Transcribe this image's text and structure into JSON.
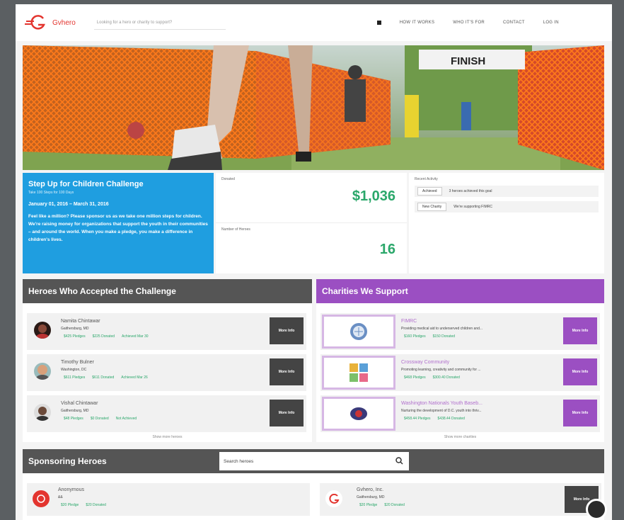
{
  "brand": {
    "name": "Gvhero",
    "accent": "#e3352f"
  },
  "search": {
    "placeholder": "Looking for a hero or charity to support?"
  },
  "nav": {
    "links": [
      "HOW IT WORKS",
      "WHO IT'S FOR",
      "CONTACT",
      "LOG IN"
    ]
  },
  "hero": {
    "finish_banner": "FINISH"
  },
  "challenge": {
    "title": "Step Up for Children Challenge",
    "subtitle": "Take 100 Steps for 100 Days",
    "dates": "January 01, 2016 – March 31, 2016",
    "description": "Feel like a million? Please sponsor us as we take one million steps for children. We're raising money for organizations that support the youth in their communities – and around the world. When you make a pledge, you make a difference in children's lives."
  },
  "stats": {
    "donated_label": "Donated",
    "donated_value": "$1,036",
    "heroes_label": "Number of Heroes",
    "heroes_value": "16"
  },
  "activity": {
    "label": "Recent Activity",
    "items": [
      {
        "tag": "Achieved",
        "text": "3 heroes achieved this goal"
      },
      {
        "tag": "New Charity",
        "text": "We're supporting FIMRC"
      }
    ]
  },
  "heroes": {
    "title": "Heroes Who Accepted the Challenge",
    "rows": [
      {
        "name": "Namita Chintawar",
        "location": "Gaithersburg, MD",
        "pledges": "$425 Pledges",
        "donated": "$225 Donated",
        "status": "Achieved Mar 30"
      },
      {
        "name": "Timothy Bulner",
        "location": "Washington, DC",
        "pledges": "$611 Pledges",
        "donated": "$611 Donated",
        "status": "Achieved Mar 26"
      },
      {
        "name": "Vishal Chintawar",
        "location": "Gaithersburg, MD",
        "pledges": "$48 Pledges",
        "donated": "$0 Donated",
        "status": "Not Achieved"
      }
    ],
    "more_label": "More Info",
    "show_more": "Show more heroes"
  },
  "charities": {
    "title": "Charities We Support",
    "rows": [
      {
        "name": "FIMRC",
        "desc": "Providing medical aid to underserved children and...",
        "pledges": "$160 Pledges",
        "donated": "$150 Donated"
      },
      {
        "name": "Crossway Community",
        "desc": "Promoting learning, creativity and community for ...",
        "pledges": "$468 Pledges",
        "donated": "$300.40 Donated"
      },
      {
        "name": "Washington Nationals Youth Baseb...",
        "desc": "Nurturing the development of D.C. youth into thriv...",
        "pledges": "$458.44 Pledges",
        "donated": "$438.44 Donated"
      }
    ],
    "more_label": "More Info",
    "show_more": "Show more charities"
  },
  "sponsoring": {
    "title": "Sponsoring Heroes",
    "search_placeholder": "Search heroes",
    "cards": [
      {
        "name": "Anonymous",
        "location": "&&",
        "pledges": "$20 Pledge",
        "donated": "$20 Donated"
      },
      {
        "name": "Gvhero, Inc.",
        "location": "Gaithersburg, MD",
        "pledges": "$20 Pledge",
        "donated": "$20 Donated"
      }
    ],
    "more_label": "More Info"
  }
}
